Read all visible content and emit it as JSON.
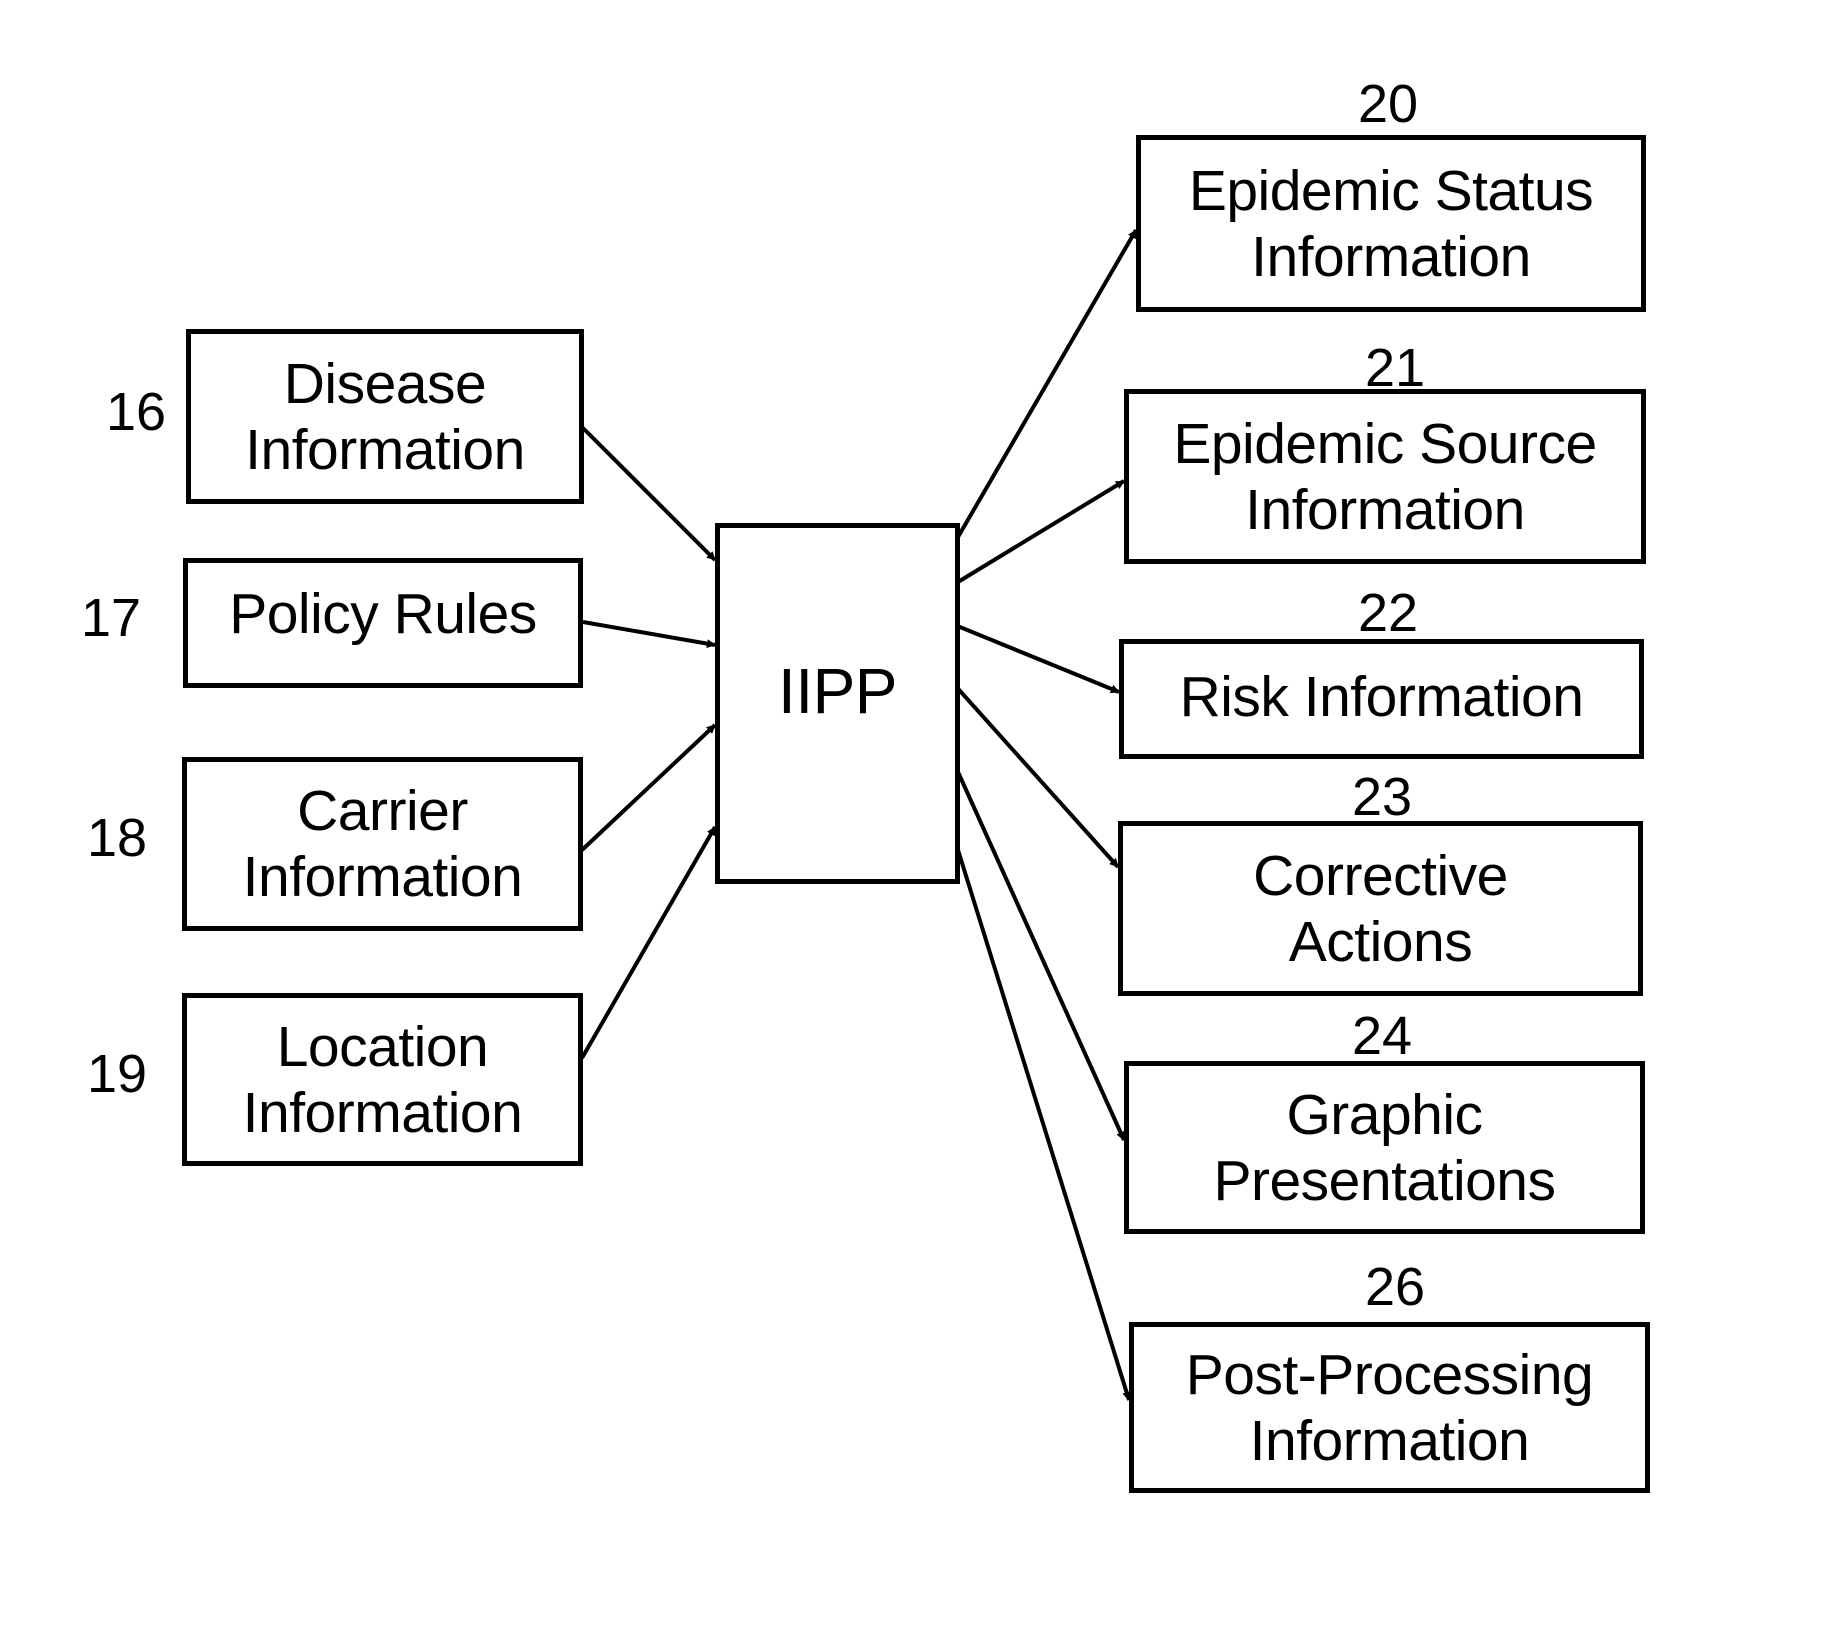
{
  "diagram": {
    "center": {
      "id": "iipp",
      "label": "IIPP"
    },
    "inputs": [
      {
        "id": "disease",
        "ref": "16",
        "label": "Disease\nInformation"
      },
      {
        "id": "policy",
        "ref": "17",
        "label": "Policy Rules"
      },
      {
        "id": "carrier",
        "ref": "18",
        "label": "Carrier\nInformation"
      },
      {
        "id": "location",
        "ref": "19",
        "label": "Location\nInformation"
      }
    ],
    "outputs": [
      {
        "id": "epidemic-status",
        "ref": "20",
        "label": "Epidemic Status\nInformation"
      },
      {
        "id": "epidemic-source",
        "ref": "21",
        "label": "Epidemic Source\nInformation"
      },
      {
        "id": "risk",
        "ref": "22",
        "label": "Risk Information"
      },
      {
        "id": "corrective",
        "ref": "23",
        "label": "Corrective\nActions"
      },
      {
        "id": "graphic",
        "ref": "24",
        "label": "Graphic\nPresentations"
      },
      {
        "id": "post-processing",
        "ref": "26",
        "label": "Post-Processing\nInformation"
      }
    ],
    "edges": [
      {
        "from": "disease",
        "to": "iipp"
      },
      {
        "from": "policy",
        "to": "iipp"
      },
      {
        "from": "carrier",
        "to": "iipp"
      },
      {
        "from": "location",
        "to": "iipp"
      },
      {
        "from": "iipp",
        "to": "epidemic-status"
      },
      {
        "from": "iipp",
        "to": "epidemic-source"
      },
      {
        "from": "iipp",
        "to": "risk"
      },
      {
        "from": "iipp",
        "to": "corrective"
      },
      {
        "from": "iipp",
        "to": "graphic"
      },
      {
        "from": "iipp",
        "to": "post-processing"
      }
    ]
  }
}
